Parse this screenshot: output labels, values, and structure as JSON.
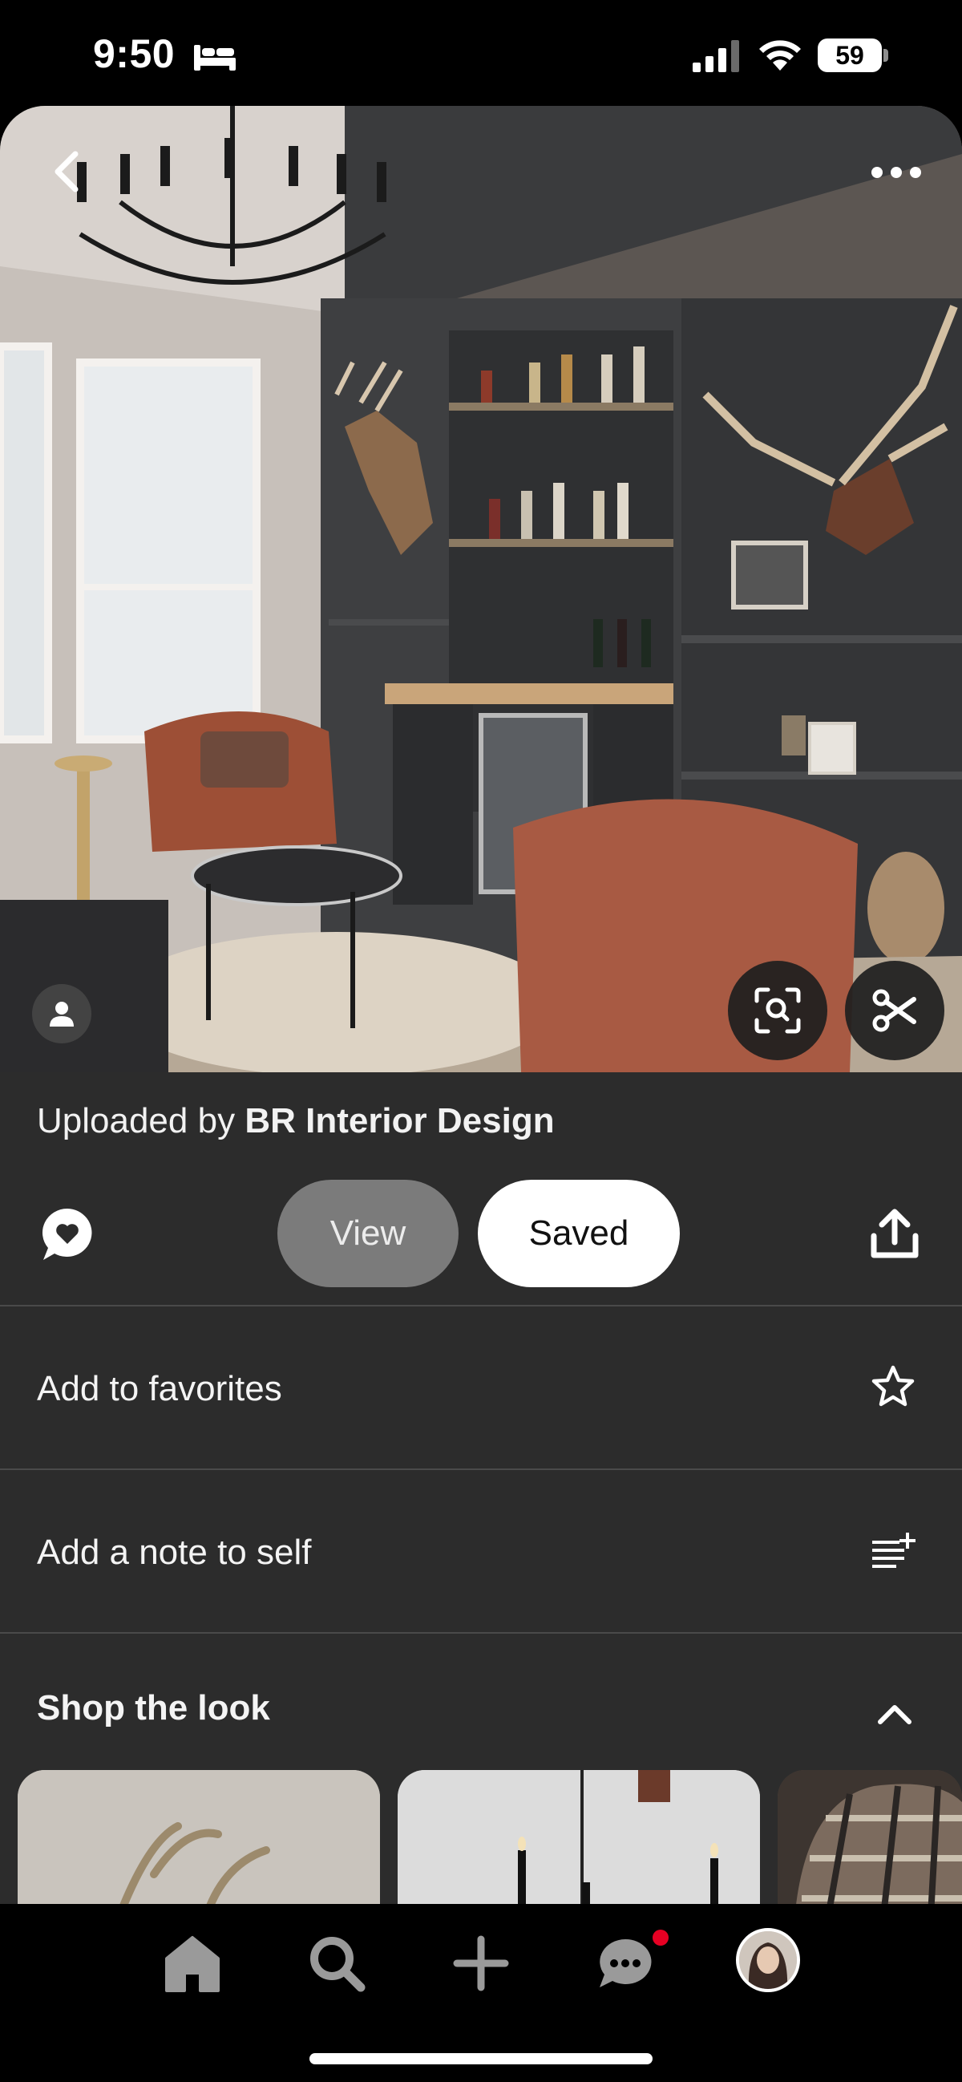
{
  "status_bar": {
    "time": "9:50",
    "battery": "59",
    "icons": [
      "sleep-focus-icon",
      "signal-icon",
      "wifi-icon",
      "battery-icon"
    ]
  },
  "photo": {
    "icons": [
      "back-chevron-icon",
      "more-dots-icon",
      "account-icon",
      "visual-search-icon",
      "scissors-icon"
    ]
  },
  "pin": {
    "uploaded_by_prefix": "Uploaded by",
    "uploader_name": "BR Interior Design",
    "view_label": "View",
    "saved_label": "Saved"
  },
  "menu": {
    "favorites_label": "Add to favorites",
    "note_label": "Add a note to self",
    "shop_title": "Shop the look"
  },
  "tab_bar": {
    "items": [
      "home-icon",
      "search-icon",
      "create-icon",
      "messages-icon",
      "profile-avatar"
    ]
  },
  "colors": {
    "panel_bg": "#2c2c2c",
    "view_button": "#7b7b7b",
    "saved_button": "#ffffff",
    "notification": "#e60023"
  }
}
